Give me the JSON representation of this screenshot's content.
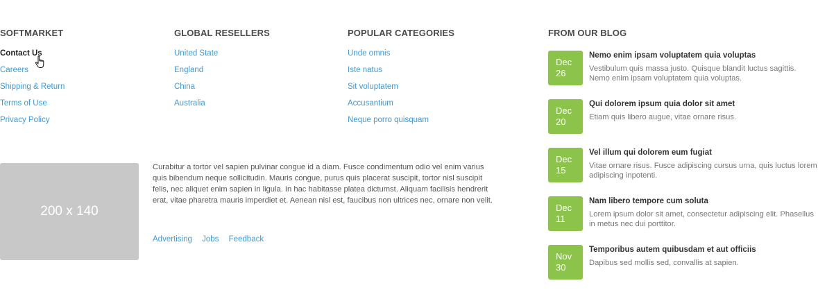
{
  "softmarket": {
    "title": "SOFTMARKET",
    "links": [
      "Contact Us",
      "Careers",
      "Shipping & Return",
      "Terms of Use",
      "Privacy Policy"
    ]
  },
  "resellers": {
    "title": "GLOBAL RESELLERS",
    "links": [
      "United State",
      "England",
      "China",
      "Australia"
    ]
  },
  "categories": {
    "title": "POPULAR CATEGORIES",
    "links": [
      "Unde omnis",
      "Iste natus",
      "Sit voluptatem",
      "Accusantium",
      "Neque porro quisquam"
    ]
  },
  "about": {
    "image_label": "200 x 140",
    "text": "Curabitur a tortor vel sapien pulvinar congue id a diam. Fusce condimentum odio vel enim varius quis bibendum neque sollicitudin. Mauris congue, purus quis placerat suscipit, tortor nisl suscipit felis, nec aliquet enim sapien in ligula. In hac habitasse platea dictumst. Aliquam facilisis hendrerit erat, vitae pharetra mauris imperdiet et. Aenean nisl est, faucibus non ultrices nec, ornare non velit.",
    "links": [
      "Advertising",
      "Jobs",
      "Feedback"
    ]
  },
  "blog": {
    "title": "FROM OUR BLOG",
    "posts": [
      {
        "month": "Dec",
        "day": "26",
        "title": "Nemo enim ipsam voluptatem quia voluptas",
        "excerpt": "Vestibulum quis massa justo. Quisque blandit luctus sagittis. Nemo enim ipsam voluptatem quia voluptas."
      },
      {
        "month": "Dec",
        "day": "20",
        "title": "Qui dolorem ipsum quia dolor sit amet",
        "excerpt": "Etiam quis libero augue, vitae ornare risus."
      },
      {
        "month": "Dec",
        "day": "15",
        "title": "Vel illum qui dolorem eum fugiat",
        "excerpt": "Vitae ornare risus. Fusce adipiscing cursus urna, quis luctus lorem adipiscing inpotenti."
      },
      {
        "month": "Dec",
        "day": "11",
        "title": "Nam libero tempore cum soluta",
        "excerpt": "Lorem ipsum dolor sit amet, consectetur adipiscing elit. Phasellus in metus nec dui porttitor."
      },
      {
        "month": "Nov",
        "day": "30",
        "title": "Temporibus autem quibusdam et aut officiis",
        "excerpt": "Dapibus sed mollis sed, convallis at sapien."
      }
    ]
  },
  "colors": {
    "link": "#3f9ad6",
    "badge": "#8cc34b",
    "placeholder": "#c8c8c8"
  },
  "icons": {
    "cursor": "hand-pointer-icon"
  }
}
